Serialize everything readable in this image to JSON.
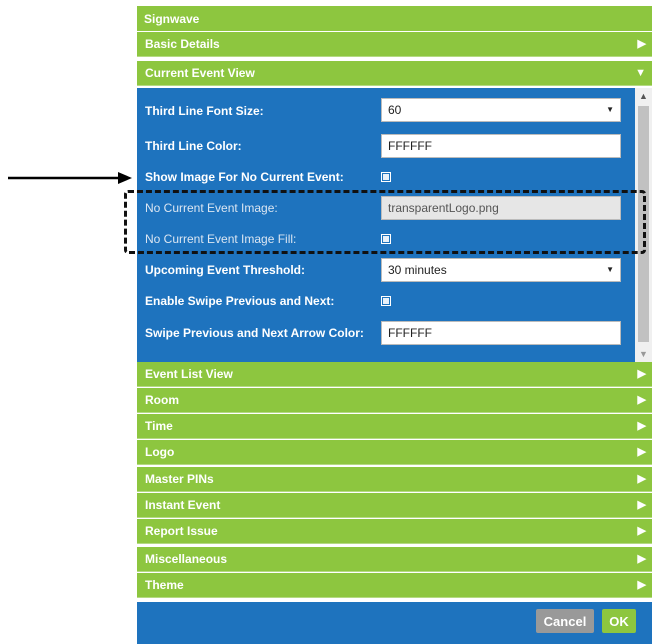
{
  "app_title": "Signwave",
  "sections_top": [
    {
      "label": "Basic Details",
      "arrow": "▶"
    },
    {
      "label": "Current Event View",
      "arrow": "▼"
    }
  ],
  "current_event_view": {
    "third_line_font_size": {
      "label": "Third Line Font Size:",
      "value": "60"
    },
    "third_line_color": {
      "label": "Third Line Color:",
      "value": "FFFFFF"
    },
    "show_image_no_event": {
      "label": "Show Image For No Current Event:",
      "checked": true
    },
    "no_event_image": {
      "label": "No Current Event Image:",
      "value": "transparentLogo.png"
    },
    "no_event_image_fill": {
      "label": "No Current Event Image Fill:",
      "checked": true
    },
    "upcoming_threshold": {
      "label": "Upcoming Event Threshold:",
      "value": "30 minutes"
    },
    "enable_swipe": {
      "label": "Enable Swipe Previous and Next:",
      "checked": true
    },
    "swipe_arrow_color": {
      "label": "Swipe Previous and Next Arrow Color:",
      "value": "FFFFFF"
    }
  },
  "sections_bottom": [
    {
      "label": "Event List View",
      "arrow": "▶"
    },
    {
      "label": "Room",
      "arrow": "▶"
    },
    {
      "label": "Time",
      "arrow": "▶"
    },
    {
      "label": "Logo",
      "arrow": "▶"
    },
    {
      "label": "Master PINs",
      "arrow": "▶"
    },
    {
      "label": "Instant Event",
      "arrow": "▶"
    },
    {
      "label": "Report Issue",
      "arrow": "▶"
    },
    {
      "label": "Miscellaneous",
      "arrow": "▶"
    },
    {
      "label": "Theme",
      "arrow": "▶"
    }
  ],
  "footer": {
    "cancel_label": "Cancel",
    "ok_label": "OK"
  },
  "colors": {
    "green": "#8dc63f",
    "blue": "#1e73be",
    "gray_button": "#999999"
  }
}
